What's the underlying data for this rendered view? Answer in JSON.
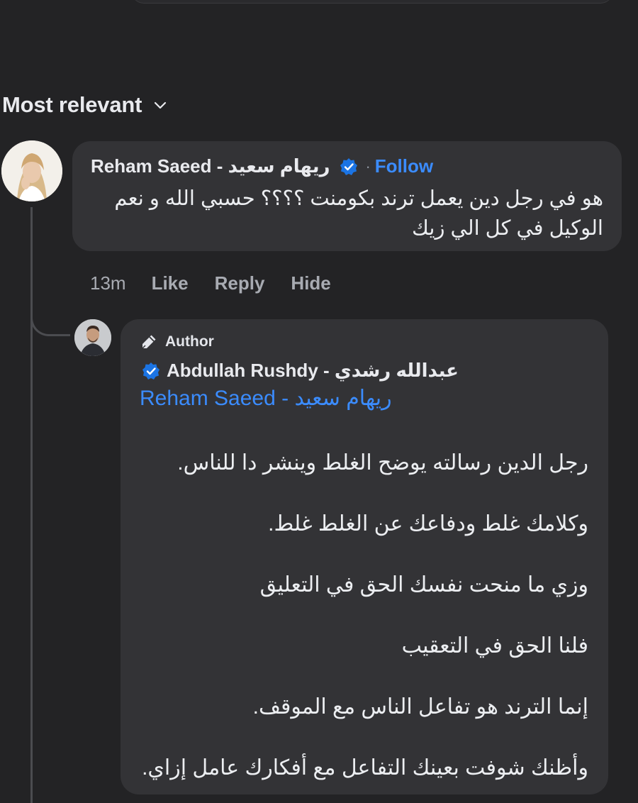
{
  "sort": {
    "label": "Most relevant"
  },
  "comment": {
    "author": "Reham Saeed - ريهام سعيد",
    "separator": "·",
    "follow_label": "Follow",
    "text": "هو في رجل دين يعمل ترند بكومنت ؟؟؟؟ حسبي الله و نعم الوكيل في كل الي زيك",
    "time": "13m",
    "actions": {
      "like": "Like",
      "reply": "Reply",
      "hide": "Hide"
    }
  },
  "reply": {
    "badge": "Author",
    "author": "Abdullah Rushdy - عبدالله رشدي",
    "mention": "Reham Saeed - ريهام سعيد",
    "lines": [
      "رجل الدين رسالته يوضح الغلط وينشر دا للناس.",
      "وكلامك غلط ودفاعك عن الغلط غلط.",
      "وزي ما منحت نفسك الحق في التعليق",
      "فلنا الحق في التعقيب",
      "إنما الترند هو تفاعل الناس مع الموقف.",
      "وأظنك شوفت بعينك التفاعل مع أفكارك عامل إزاي."
    ]
  },
  "colors": {
    "background": "#232325",
    "bubble": "#333336",
    "link_blue": "#3b8cff",
    "muted": "#a8abb2"
  },
  "icons": {
    "sort": "chevron-down-icon",
    "verified": "verified-badge-icon",
    "author": "pencil-icon"
  }
}
